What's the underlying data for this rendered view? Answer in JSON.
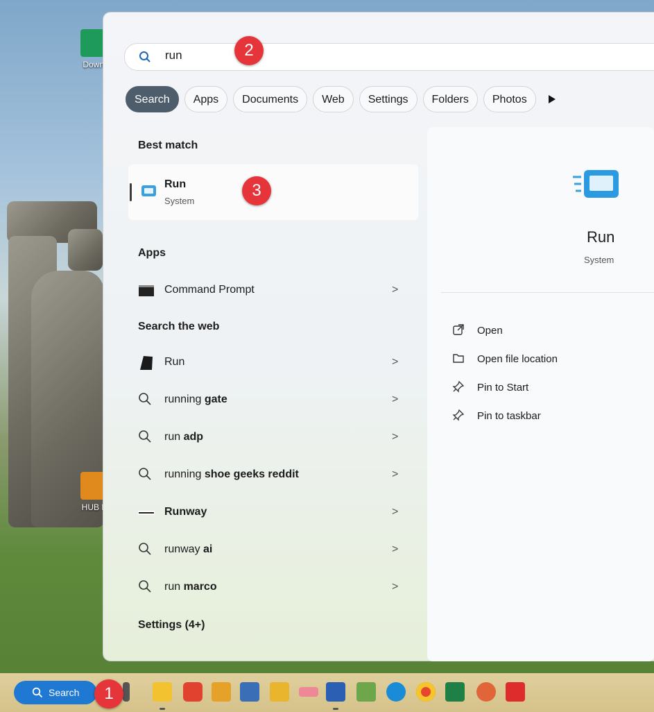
{
  "desktop": {
    "icons": [
      {
        "label": "Downl"
      },
      {
        "label": "HUB P"
      }
    ]
  },
  "search": {
    "value": "run",
    "icon": "search-icon"
  },
  "filters": [
    "Search",
    "Apps",
    "Documents",
    "Web",
    "Settings",
    "Folders",
    "Photos"
  ],
  "best_match": {
    "heading": "Best match",
    "title": "Run",
    "subtitle": "System"
  },
  "apps": {
    "heading": "Apps",
    "items": [
      {
        "label": "Command Prompt",
        "chevron": ">"
      }
    ]
  },
  "web": {
    "heading": "Search the web",
    "items": [
      {
        "prefix": "Run",
        "bold": "",
        "chevron": ">"
      },
      {
        "prefix": "running ",
        "bold": "gate",
        "chevron": ">"
      },
      {
        "prefix": "run ",
        "bold": "adp",
        "chevron": ">"
      },
      {
        "prefix": "running ",
        "bold": "shoe geeks reddit",
        "chevron": ">"
      },
      {
        "prefix": "",
        "bold": "Runway",
        "chevron": ">"
      },
      {
        "prefix": "runway ",
        "bold": "ai",
        "chevron": ">"
      },
      {
        "prefix": "run ",
        "bold": "marco",
        "chevron": ">"
      }
    ]
  },
  "settings_heading": "Settings (4+)",
  "detail": {
    "title": "Run",
    "subtitle": "System",
    "actions": [
      "Open",
      "Open file location",
      "Pin to Start",
      "Pin to taskbar"
    ]
  },
  "taskbar": {
    "search_label": "Search"
  },
  "badges": [
    "1",
    "2",
    "3"
  ],
  "colors": {
    "accent": "#1f78d1",
    "badge": "#e5343a",
    "chip_active": "#4d5d6b"
  }
}
